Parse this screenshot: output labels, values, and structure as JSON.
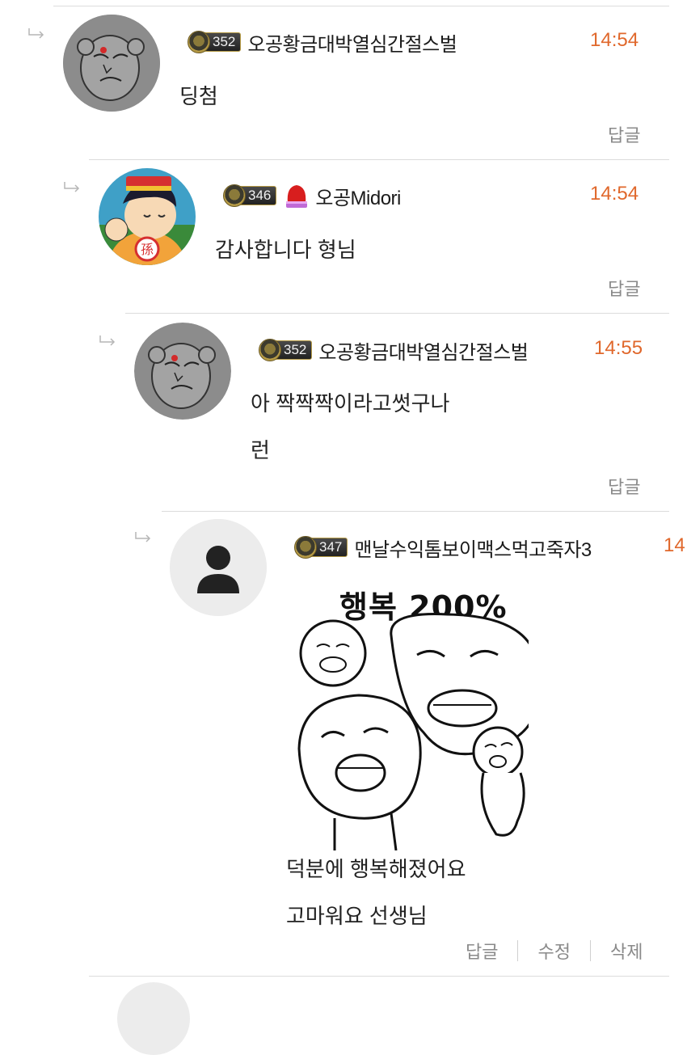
{
  "comments": [
    {
      "level": "352",
      "nickname": "오공황금대박열심간절스벌",
      "time": "14:54",
      "lines": [
        "딩첨"
      ],
      "reply_label": "답글",
      "avatar": "sketch-face-avatar"
    },
    {
      "level": "346",
      "nickname": "오공Midori",
      "time": "14:54",
      "lines": [
        "감사합니다 형님"
      ],
      "reply_label": "답글",
      "avatar": "cartoon-boy-avatar",
      "badge_icon": "red-hat-icon"
    },
    {
      "level": "352",
      "nickname": "오공황금대박열심간절스벌",
      "time": "14:55",
      "lines": [
        "아 짝짝짝이라고썻구나",
        "런"
      ],
      "reply_label": "답글",
      "avatar": "sketch-face-avatar"
    },
    {
      "level": "347",
      "nickname": "맨날수익톰보이맥스먹고죽자3",
      "time": "14",
      "sticker_caption": "행복 200%",
      "lines": [
        "덕분에 행복해졌어요",
        "고마워요 선생님"
      ],
      "reply_label": "답글",
      "edit_label": "수정",
      "delete_label": "삭제",
      "avatar": "default-user-avatar"
    }
  ],
  "colors": {
    "time": "#e0682c",
    "action": "#8a8a8a",
    "divider": "#dcdcdc"
  }
}
